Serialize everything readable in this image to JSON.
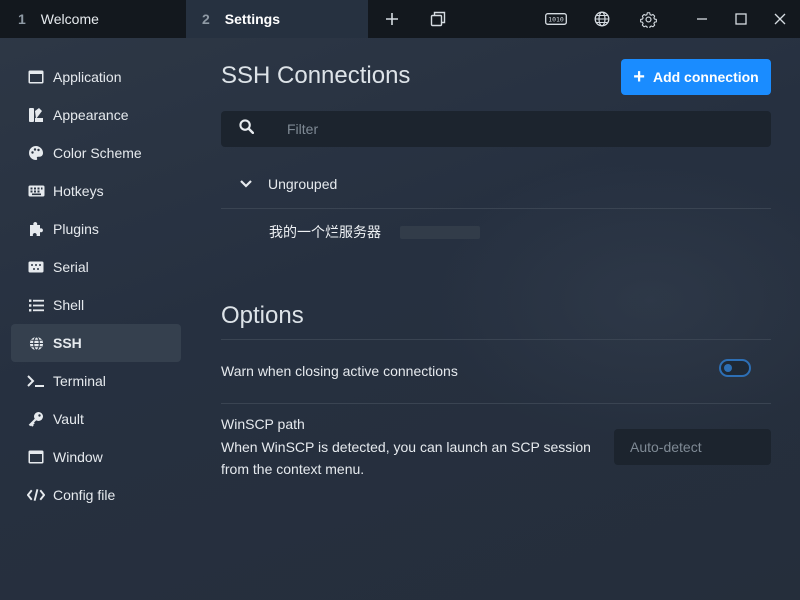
{
  "tabs": [
    {
      "number": "1",
      "label": "Welcome"
    },
    {
      "number": "2",
      "label": "Settings"
    }
  ],
  "titlebar_icons": [
    "plus-icon",
    "duplicate-window-icon",
    "serial-binary-icon",
    "globe-icon",
    "gear-icon",
    "minimize-icon",
    "maximize-icon",
    "close-icon"
  ],
  "sidebar": {
    "items": [
      {
        "label": "Application",
        "icon": "application-window-icon"
      },
      {
        "label": "Appearance",
        "icon": "palette-brush-icon"
      },
      {
        "label": "Color Scheme",
        "icon": "palette-icon"
      },
      {
        "label": "Hotkeys",
        "icon": "keyboard-icon"
      },
      {
        "label": "Plugins",
        "icon": "puzzle-icon"
      },
      {
        "label": "Serial",
        "icon": "serial-port-icon"
      },
      {
        "label": "Shell",
        "icon": "list-icon"
      },
      {
        "label": "SSH",
        "icon": "globe-icon",
        "active": true
      },
      {
        "label": "Terminal",
        "icon": "terminal-prompt-icon"
      },
      {
        "label": "Vault",
        "icon": "key-icon"
      },
      {
        "label": "Window",
        "icon": "window-icon"
      },
      {
        "label": "Config file",
        "icon": "code-icon"
      }
    ]
  },
  "ssh": {
    "title": "SSH Connections",
    "add_button": "Add connection",
    "filter_placeholder": "Filter",
    "group": "Ungrouped",
    "connections": [
      {
        "name": "我的一个烂服务器"
      }
    ]
  },
  "options": {
    "title": "Options",
    "warn_label": "Warn when closing active connections",
    "warn_enabled": false,
    "winscp_label": "WinSCP path",
    "winscp_description": "When WinSCP is detected, you can launch an SCP session from the context menu.",
    "winscp_placeholder": "Auto-detect"
  },
  "colors": {
    "accent": "#1a8cff",
    "tabbar_bg": "#13181e",
    "sidebar_active_bg": "#35404e",
    "input_bg": "#1c242e"
  }
}
